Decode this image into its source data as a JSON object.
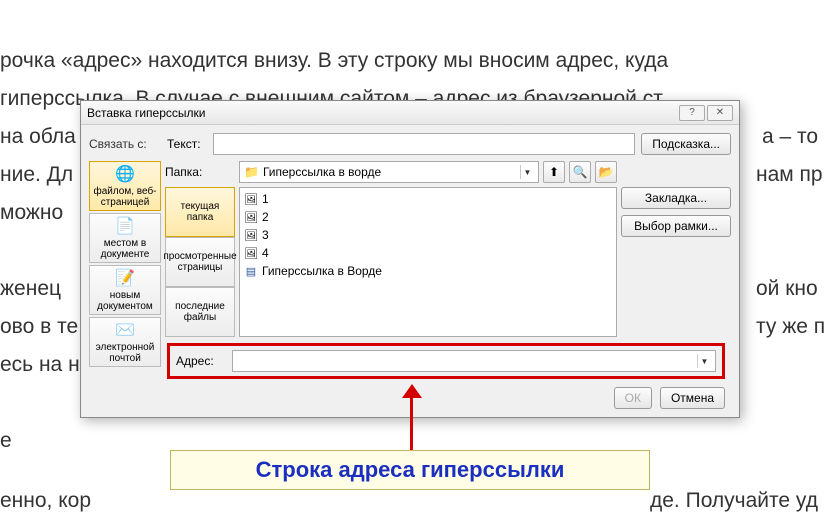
{
  "bg": {
    "l1": "рочка «адрес» находится внизу. В эту строку мы вносим адрес, куда",
    "l2": "гиперссылка. В случае с внешним сайтом – адрес из браузерной ст",
    "l3a": "на обла",
    "l3b": "а – то",
    "l4a": "ние. Дл",
    "l4b": "нам пр",
    "l5": "можно",
    "l6a": "женец",
    "l6b": "ой кно",
    "l7a": "ово в те",
    "l7b": "ту же п",
    "l8": "есь на н",
    "l9": "е",
    "l10a": "енно, кор",
    "l10b": "де. Получайте уд"
  },
  "dialog": {
    "title": "Вставка гиперссылки",
    "linkto_label": "Связать с:",
    "text_label": "Текст:",
    "text_value": "",
    "hint_btn": "Подсказка...",
    "folder_label": "Папка:",
    "folder_value": "Гиперссылка в ворде",
    "bookmark_btn": "Закладка...",
    "frame_btn": "Выбор рамки...",
    "address_label": "Адрес:",
    "address_value": "",
    "ok_btn": "ОК",
    "cancel_btn": "Отмена"
  },
  "linkto": [
    {
      "label": "файлом, веб-страницей",
      "icon": "globe"
    },
    {
      "label": "местом в документе",
      "icon": "doc"
    },
    {
      "label": "новым документом",
      "icon": "newdoc"
    },
    {
      "label": "электронной почтой",
      "icon": "mail"
    }
  ],
  "browse_tabs": [
    {
      "label": "текущая папка"
    },
    {
      "label": "просмотренные страницы"
    },
    {
      "label": "последние файлы"
    }
  ],
  "files": [
    {
      "name": "1",
      "type": "image"
    },
    {
      "name": "2",
      "type": "image"
    },
    {
      "name": "3",
      "type": "image"
    },
    {
      "name": "4",
      "type": "image"
    },
    {
      "name": "Гиперссылка в Ворде",
      "type": "word"
    }
  ],
  "caption": "Строка адреса гиперссылки",
  "chart_data": {
    "type": "table"
  }
}
